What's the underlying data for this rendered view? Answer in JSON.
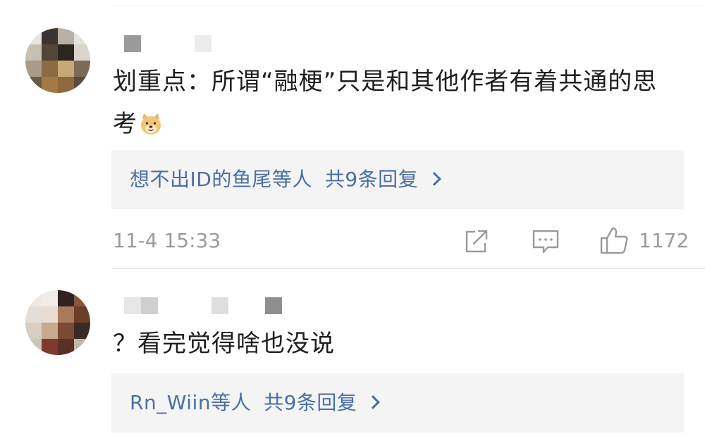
{
  "comments": [
    {
      "text": "划重点：所谓“融梗”只是和其他作者有着共通的思考",
      "emoji": "doge-emoji",
      "reply_summary": {
        "names": "想不出ID的鱼尾等人",
        "count": "共9条回复"
      },
      "time": "11-4 15:33",
      "likes": "1172",
      "icons": [
        "share-icon",
        "comment-icon",
        "like-icon"
      ]
    },
    {
      "text": "？看完觉得啥也没说",
      "reply_summary": {
        "names": "Rn_Wiin等人",
        "count": "共9条回复"
      }
    }
  ],
  "colors": {
    "link": "#4a6fa5",
    "meta": "#9a9a9a",
    "reply_bg": "#f4f4f4"
  }
}
